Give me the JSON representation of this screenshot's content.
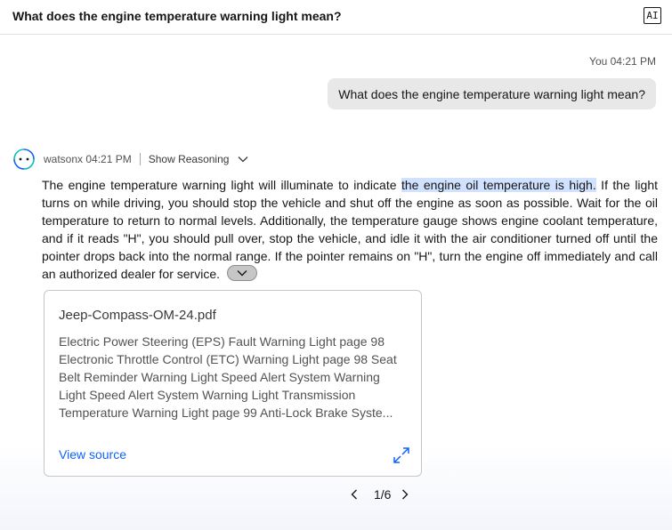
{
  "header": {
    "title": "What does the engine temperature warning light mean?",
    "ai_badge": "AI"
  },
  "user_message": {
    "meta": "You 04:21 PM",
    "text": "What does the engine temperature warning light mean?"
  },
  "bot_message": {
    "meta": "watsonx 04:21 PM",
    "reasoning_label": "Show Reasoning",
    "answer_before": "The engine temperature warning light will illuminate to indicate ",
    "answer_highlight": "the engine oil temperature is high.",
    "answer_after": " If the light turns on while driving, you should stop the vehicle and shut off the engine as soon as possible. Wait for the oil temperature to return to normal levels. Additionally, the temperature gauge shows engine coolant temperature, and if it reads \"H\", you should pull over, stop the vehicle, and idle it with the air conditioner turned off until the pointer drops back into the normal range. If the pointer remains on \"H\", turn the engine off immediately and call an authorized dealer for service."
  },
  "source_card": {
    "title": "Jeep-Compass-OM-24.pdf",
    "excerpt": "Electric Power Steering (EPS) Fault Warning Light page 98 Electronic Throttle Control (ETC) Warning Light page 98 Seat Belt Reminder Warning Light Speed Alert System Warning Light Speed Alert System Warning Light Transmission Temperature Warning Light page 99 Anti-Lock Brake Syste...",
    "view_source_label": "View source"
  },
  "pager": {
    "label": "1/6"
  },
  "colors": {
    "highlight": "#d0e2ff",
    "link": "#0f62fe",
    "avatar_blue": "#0f62fe",
    "avatar_teal": "#08bdba"
  }
}
